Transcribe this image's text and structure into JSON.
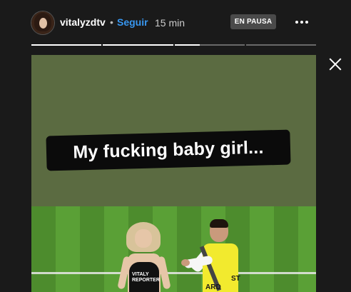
{
  "header": {
    "username": "vitalyzdtv",
    "separator": "•",
    "follow_label": "Seguir",
    "time_ago": "15 min",
    "status_badge": "EN PAUSA",
    "more_icon": "more-horizontal-icon"
  },
  "progress": {
    "segments": [
      {
        "fill": 1.0
      },
      {
        "fill": 1.0
      },
      {
        "fill": 0.36
      },
      {
        "fill": 0.0
      }
    ]
  },
  "controls": {
    "close_icon": "close-icon"
  },
  "story": {
    "caption": "My fucking baby girl...",
    "woman_shirt_text": "VITALY\nREPORTER",
    "steward_vest_text": "ARD",
    "steward_vest_text2": "ST"
  },
  "colors": {
    "background": "#1a1a1a",
    "follow_link": "#3897f0",
    "media_top": "#5b6b41",
    "pitch_green": "#5aa036",
    "vest_yellow": "#f2ea2e"
  }
}
